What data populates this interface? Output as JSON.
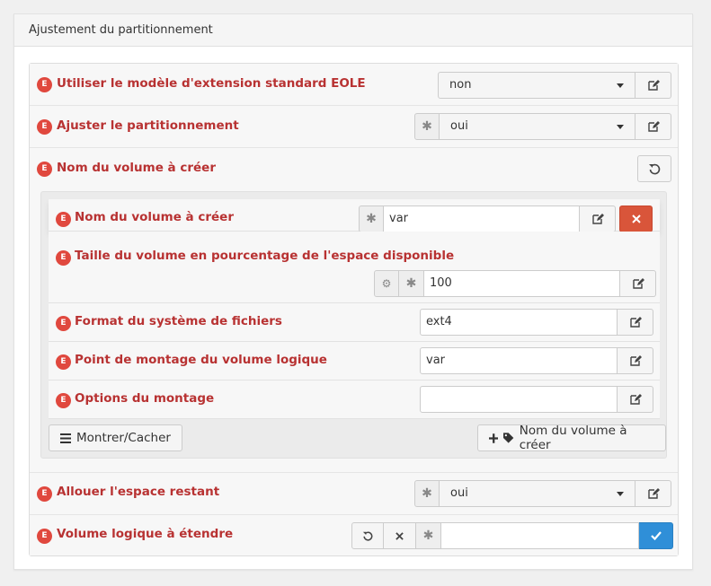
{
  "panel": {
    "title": "Ajustement du partitionnement"
  },
  "badge_letter": "E",
  "rows": {
    "extension_model": {
      "label": "Utiliser le modèle d'extension standard EOLE",
      "value": "non"
    },
    "adjust_partition": {
      "label": "Ajuster le partitionnement",
      "value": "oui"
    },
    "volume_name_group": {
      "label": "Nom du volume à créer"
    },
    "allocate_space": {
      "label": "Allouer l'espace restant",
      "value": "oui"
    },
    "extend_volume": {
      "label": "Volume logique à étendre",
      "value": ""
    }
  },
  "group": {
    "volume_name": {
      "label": "Nom du volume à créer",
      "value": "var"
    },
    "volume_size": {
      "label": "Taille du volume en pourcentage de l'espace disponible",
      "value": "100"
    },
    "fs_format": {
      "label": "Format du système de fichiers",
      "value": "ext4"
    },
    "mount_point": {
      "label": "Point de montage du volume logique",
      "value": "var"
    },
    "mount_options": {
      "label": "Options du montage",
      "value": ""
    },
    "toggle_button": "Montrer/Cacher",
    "add_button": "Nom du volume à créer"
  },
  "colors": {
    "label_red": "#b83232",
    "badge_red": "#e0483e",
    "danger": "#d9553a",
    "primary": "#2f8fd8"
  }
}
